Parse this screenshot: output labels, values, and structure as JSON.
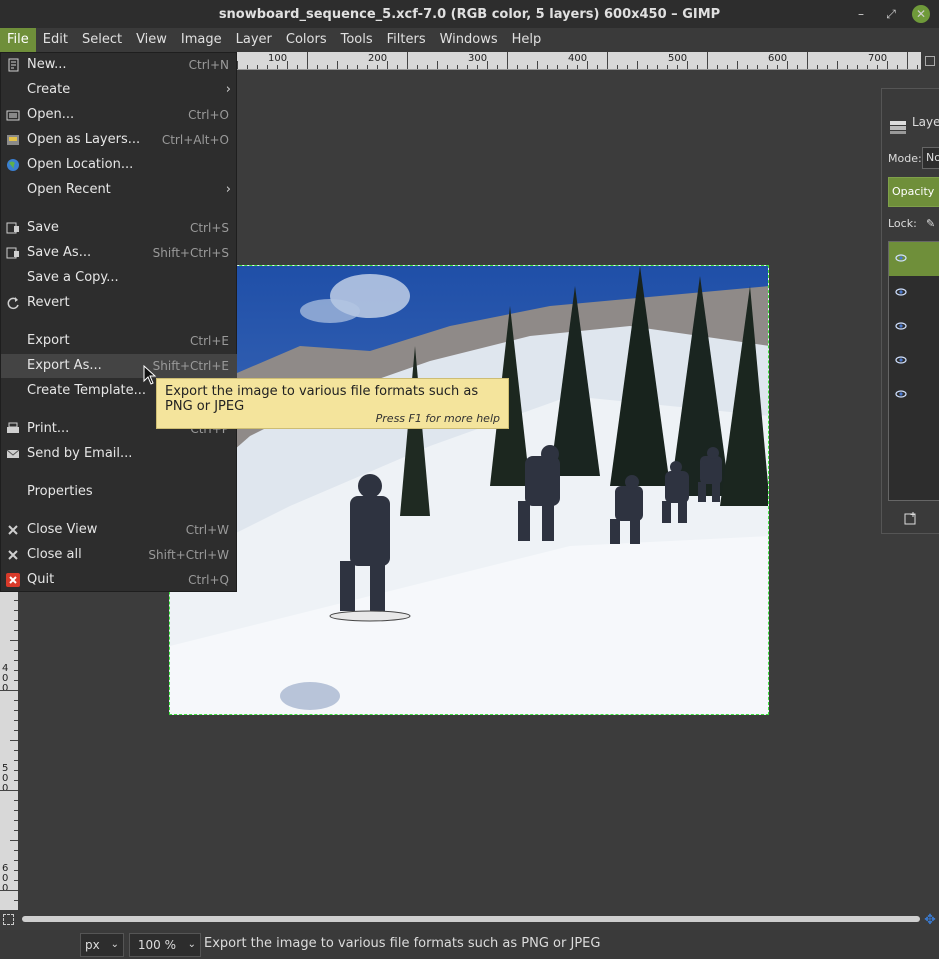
{
  "window": {
    "title": "snowboard_sequence_5.xcf-7.0 (RGB color, 5 layers) 600x450 – GIMP",
    "minimize_glyph": "–",
    "maximize_glyph": "⤢",
    "close_glyph": "✕"
  },
  "menubar": {
    "items": [
      "File",
      "Edit",
      "Select",
      "View",
      "Image",
      "Layer",
      "Colors",
      "Tools",
      "Filters",
      "Windows",
      "Help"
    ],
    "active": "File"
  },
  "ruler": {
    "h_labels": [
      "100",
      "200",
      "300",
      "400",
      "500",
      "600",
      "700"
    ],
    "v_labels": [
      "400",
      "500",
      "600"
    ]
  },
  "file_menu": {
    "items": [
      {
        "label": "New...",
        "accel": "Ctrl+N",
        "icon": "new-image-icon"
      },
      {
        "label": "Create",
        "submenu": true
      },
      {
        "label": "Open...",
        "accel": "Ctrl+O",
        "icon": "open-icon"
      },
      {
        "label": "Open as Layers...",
        "accel": "Ctrl+Alt+O",
        "icon": "open-layers-icon"
      },
      {
        "label": "Open Location...",
        "icon": "globe-icon"
      },
      {
        "label": "Open Recent",
        "submenu": true
      },
      {
        "label": "Save",
        "accel": "Ctrl+S",
        "icon": "save-icon"
      },
      {
        "label": "Save As...",
        "accel": "Shift+Ctrl+S",
        "icon": "save-as-icon"
      },
      {
        "label": "Save a Copy..."
      },
      {
        "label": "Revert",
        "icon": "revert-icon"
      },
      {
        "label": "Export",
        "accel": "Ctrl+E"
      },
      {
        "label": "Export As...",
        "accel": "Shift+Ctrl+E"
      },
      {
        "label": "Create Template..."
      },
      {
        "label": "Print...",
        "accel": "Ctrl+P",
        "icon": "print-icon"
      },
      {
        "label": "Send by Email...",
        "icon": "email-icon"
      },
      {
        "label": "Properties"
      },
      {
        "label": "Close View",
        "accel": "Ctrl+W",
        "icon": "close-view-icon"
      },
      {
        "label": "Close all",
        "accel": "Shift+Ctrl+W",
        "icon": "close-all-icon"
      },
      {
        "label": "Quit",
        "accel": "Ctrl+Q",
        "icon": "quit-icon"
      }
    ]
  },
  "tooltip": {
    "text": "Export the image to various file formats such as PNG or JPEG",
    "help": "Press F1 for more help"
  },
  "layers_panel": {
    "title": "Layers",
    "mode_label": "Mode:",
    "mode_value": "Normal",
    "opacity_label": "Opacity",
    "lock_label": "Lock:",
    "layer_count": 5
  },
  "statusbar": {
    "unit": "px",
    "zoom": "100 %",
    "message": "Export the image to various file formats such as PNG or JPEG"
  },
  "colors": {
    "accent": "#6f8f3a",
    "tooltip_bg": "#f4e49c",
    "selection_marching_ants": "#3de03d"
  }
}
